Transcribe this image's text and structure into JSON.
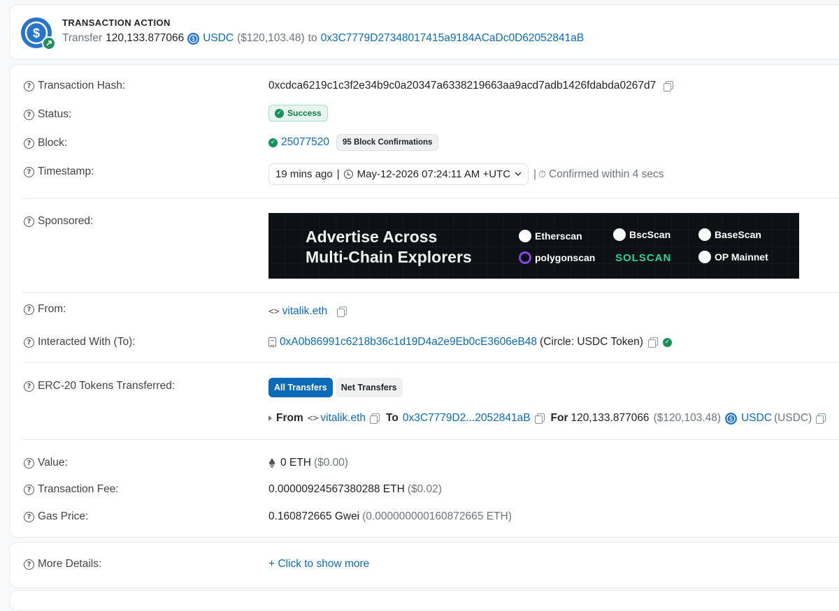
{
  "action": {
    "title": "TRANSACTION ACTION",
    "verb": "Transfer",
    "amount": "120,133.877066",
    "token": "USDC",
    "usd": "($120,103.48)",
    "to_word": "to",
    "to_address": "0x3C7779D27348017415a9184ACaDc0D62052841aB"
  },
  "rows": {
    "hash": {
      "label": "Transaction Hash:",
      "value": "0xcdca6219c1c3f2e34b9c0a20347a6338219663aa9acd7adb1426fdabda0267d7"
    },
    "status": {
      "label": "Status:",
      "value": "Success"
    },
    "block": {
      "label": "Block:",
      "value": "25077520",
      "confirmations": "95 Block Confirmations"
    },
    "timestamp": {
      "label": "Timestamp:",
      "ago": "19 mins ago",
      "sep": "|",
      "datetime": "May-12-2026 07:24:11 AM +UTC",
      "confirmed": "Confirmed within 4 secs"
    },
    "sponsored": {
      "label": "Sponsored:"
    },
    "from": {
      "label": "From:",
      "value": "vitalik.eth"
    },
    "to": {
      "label": "Interacted With (To):",
      "address": "0xA0b86991c6218b36c1d19D4a2e9Eb0cE3606eB48",
      "name": "(Circle: USDC Token)"
    },
    "erc20": {
      "label": "ERC-20 Tokens Transferred:",
      "tab_all": "All Transfers",
      "tab_net": "Net Transfers",
      "from_word": "From",
      "from_value": "vitalik.eth",
      "to_word": "To",
      "to_value": "0x3C7779D2...2052841aB",
      "for_word": "For",
      "amount": "120,133.877066",
      "usd": "($120,103.48)",
      "token": "USDC",
      "symbol": "(USDC)"
    },
    "value": {
      "label": "Value:",
      "value": "0 ETH",
      "usd": "($0.00)"
    },
    "fee": {
      "label": "Transaction Fee:",
      "value": "0.00000924567380288 ETH",
      "usd": "($0.02)"
    },
    "gas": {
      "label": "Gas Price:",
      "value": "0.160872665 Gwei",
      "eth": "(0.000000000160872665 ETH)"
    }
  },
  "ad": {
    "headline_1": "Advertise Across",
    "headline_2": "Multi-Chain Explorers",
    "logos": [
      "Etherscan",
      "BscScan",
      "BaseScan",
      "polygonscan",
      "SOLSCAN",
      "OP Mainnet"
    ]
  },
  "more": {
    "label": "More Details:",
    "link": "+ Click to show more"
  },
  "colors": {
    "link": "#0b6bb8",
    "success": "#17905c",
    "usdc": "#2775ca"
  }
}
